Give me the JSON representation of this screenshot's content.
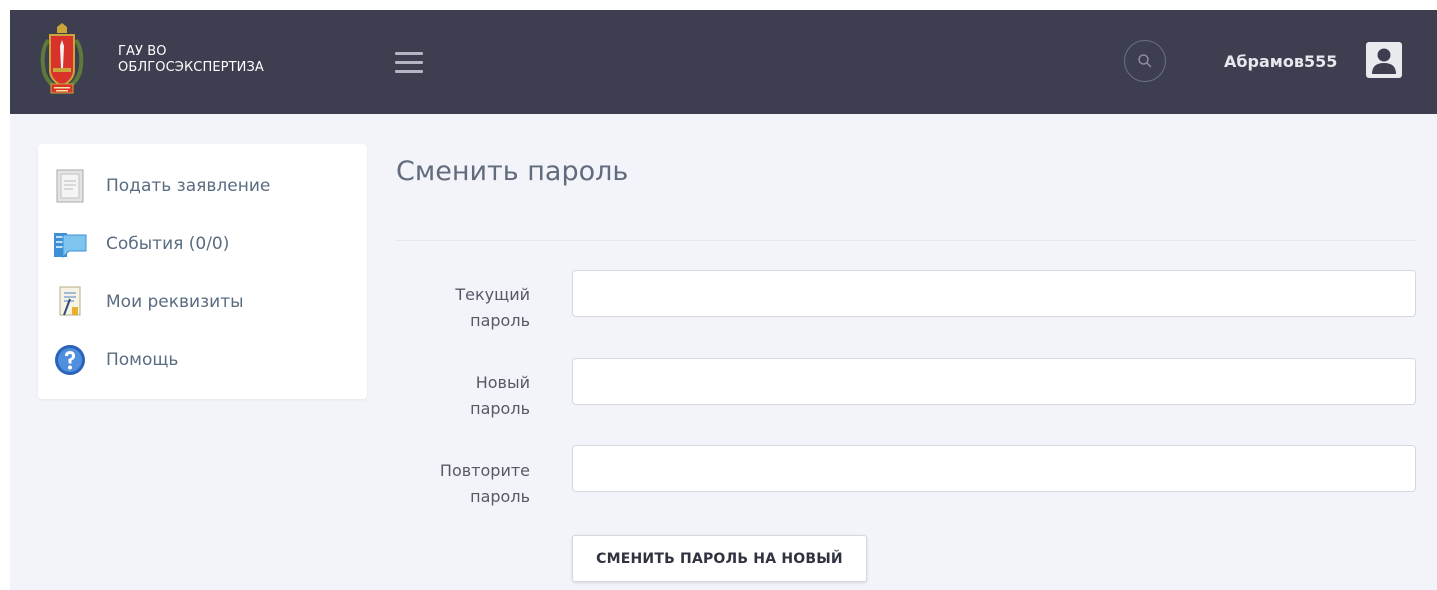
{
  "header": {
    "org_line1": "ГАУ ВО",
    "org_line2": "ОБЛГОСЭКСПЕРТИЗА",
    "emblem_icon": "volgograd-oblast-coat-of-arms-icon",
    "menu_icon": "hamburger-menu-icon",
    "search_icon": "search-icon",
    "username": "Абрамов555",
    "avatar_icon": "user-avatar-icon",
    "bg_color": "#3d3f50"
  },
  "sidebar": {
    "items": [
      {
        "label": "Подать заявление",
        "icon": "application-form-icon"
      },
      {
        "label": "События (0/0)",
        "icon": "events-icon"
      },
      {
        "label": "Мои реквизиты",
        "icon": "requisites-document-icon"
      },
      {
        "label": "Помощь",
        "icon": "help-icon"
      }
    ]
  },
  "main": {
    "title": "Сменить пароль",
    "fields": [
      {
        "label_line1": "Текущий",
        "label_line2": "пароль",
        "value": ""
      },
      {
        "label_line1": "Новый",
        "label_line2": "пароль",
        "value": ""
      },
      {
        "label_line1": "Повторите",
        "label_line2": "пароль",
        "value": ""
      }
    ],
    "submit_label": "СМЕНИТЬ ПАРОЛЬ НА НОВЫЙ"
  }
}
